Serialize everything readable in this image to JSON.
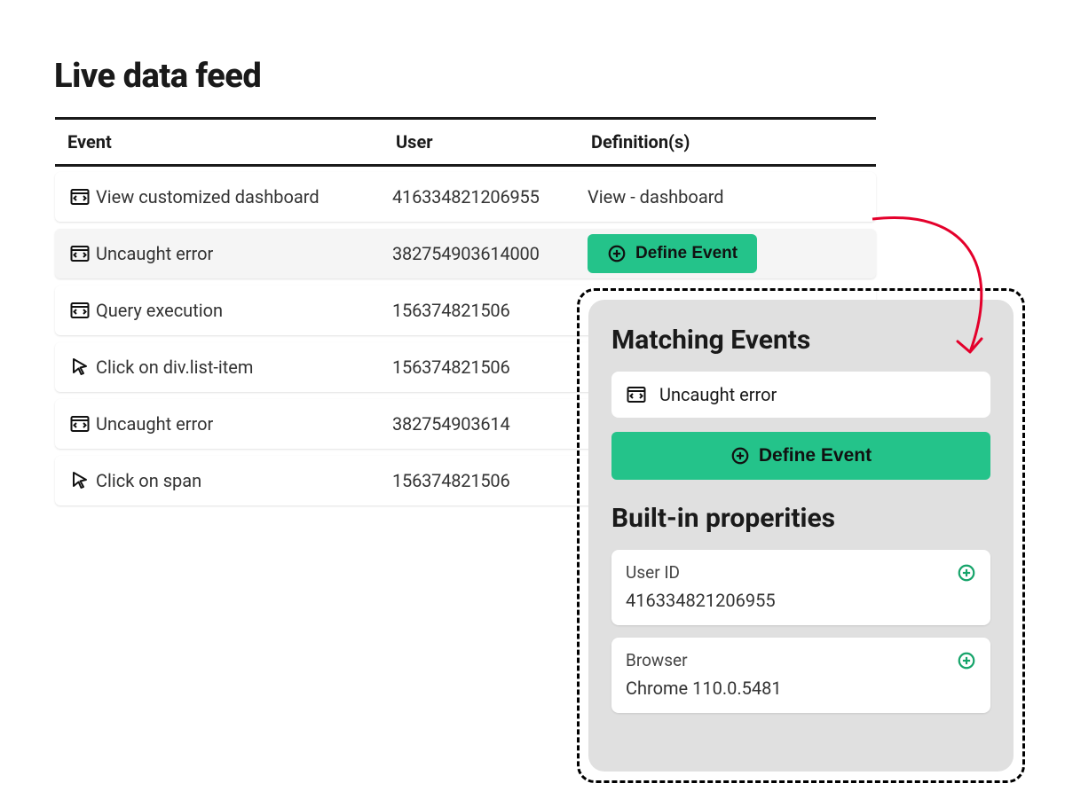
{
  "title": "Live data feed",
  "columns": {
    "event": "Event",
    "user": "User",
    "definitions": "Definition(s)"
  },
  "rows": [
    {
      "icon": "code",
      "event": "View customized dashboard",
      "user": "416334821206955",
      "definition": "View - dashboard",
      "define": false
    },
    {
      "icon": "code",
      "event": "Uncaught error",
      "user": "382754903614000",
      "definition": "",
      "define": true,
      "highlight": true
    },
    {
      "icon": "code",
      "event": "Query execution",
      "user": "156374821506",
      "definition": "",
      "define": false
    },
    {
      "icon": "cursor",
      "event": "Click on div.list-item",
      "user": "156374821506",
      "definition": "",
      "define": false
    },
    {
      "icon": "code",
      "event": "Uncaught error",
      "user": "382754903614",
      "definition": "",
      "define": false
    },
    {
      "icon": "cursor",
      "event": "Click on span",
      "user": "156374821506",
      "definition": "",
      "define": false
    }
  ],
  "define_label": "Define Event",
  "panel": {
    "matching_title": "Matching Events",
    "match_event": "Uncaught error",
    "define_label": "Define Event",
    "props_title": "Built-in properities",
    "props": [
      {
        "label": "User ID",
        "value": "416334821206955"
      },
      {
        "label": "Browser",
        "value": "Chrome 110.0.5481"
      }
    ]
  }
}
